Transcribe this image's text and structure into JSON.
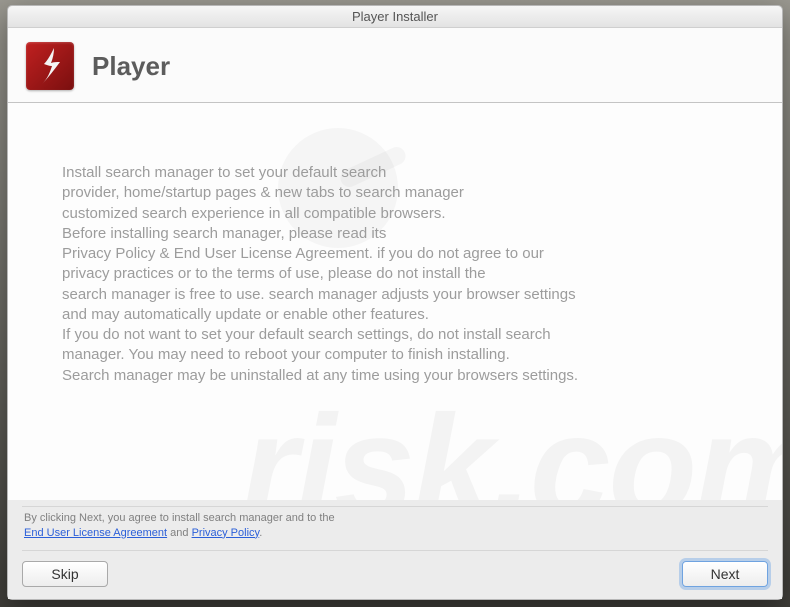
{
  "window": {
    "title": "Player Installer"
  },
  "header": {
    "app_title": "Player",
    "icon_name": "flash-player-icon"
  },
  "body": {
    "text": "Install search manager to set your default search\nprovider, home/startup pages & new tabs to search manager\ncustomized search experience in all compatible browsers.\nBefore installing search manager, please read its\nPrivacy Policy & End User License Agreement. if you do not agree to our\nprivacy practices or to the terms of use, please do not install the\nsearch manager is free to use. search manager adjusts your browser settings\nand may automatically update or enable other features.\nIf you do not want to set your default search settings, do not install search\nmanager. You may need to reboot your computer to finish installing.\nSearch manager may be uninstalled at any time using your browsers settings."
  },
  "footer": {
    "disclaimer_prefix": "By clicking Next, you agree to install search manager and to the",
    "eula_link": "End User License Agreement",
    "and": " and ",
    "privacy_link": "Privacy Policy",
    "period": "."
  },
  "buttons": {
    "skip": "Skip",
    "next": "Next"
  },
  "watermark": "risk.com"
}
